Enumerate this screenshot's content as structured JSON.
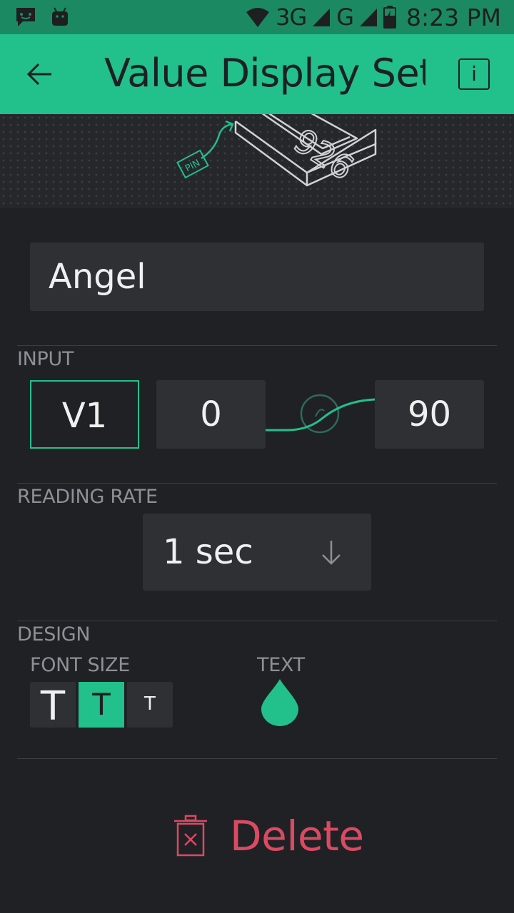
{
  "status_bar": {
    "network_1": "3G",
    "network_2": "G",
    "time": "8:23 PM",
    "icons": [
      "chat-notification-icon",
      "android-icon",
      "wifi-icon",
      "signal-icon",
      "battery-charging-icon"
    ]
  },
  "app_bar": {
    "title": "Value Display Sett",
    "info_label": "i"
  },
  "illustration": {
    "display_digits": "926",
    "pin_tag": "PIN"
  },
  "name_field": {
    "value": "Angel"
  },
  "input": {
    "section_label": "INPUT",
    "pin": "V1",
    "range_min": "0",
    "range_max": "90"
  },
  "reading_rate": {
    "section_label": "READING RATE",
    "value": "1 sec"
  },
  "design": {
    "section_label": "DESIGN",
    "font_size_label": "FONT SIZE",
    "font_options": [
      "T",
      "T",
      "T"
    ],
    "selected_font_index": 1,
    "text_label": "TEXT",
    "text_color": "#22c08a"
  },
  "delete": {
    "label": "Delete"
  },
  "colors": {
    "accent": "#22c08a",
    "status_bar": "#1b8a63",
    "background": "#202125",
    "field": "#2e3034",
    "danger": "#d94a63",
    "label": "#8d9096"
  }
}
